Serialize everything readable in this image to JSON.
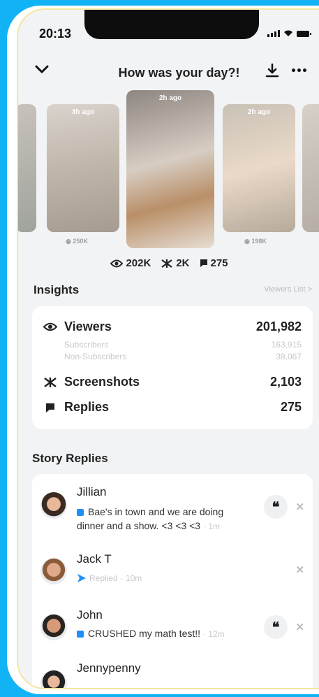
{
  "status_bar": {
    "time": "20:13"
  },
  "header": {
    "title": "How was your day?!"
  },
  "thumbnails": [
    {
      "ago": "",
      "views": ""
    },
    {
      "ago": "3h ago",
      "views": "250K"
    },
    {
      "ago": "2h ago",
      "views": ""
    },
    {
      "ago": "2h ago",
      "views": "198K"
    },
    {
      "ago": "",
      "views": ""
    }
  ],
  "stats": {
    "views": "202K",
    "screenshots": "2K",
    "replies": "275"
  },
  "insights": {
    "title": "Insights",
    "viewers_list": "Viewers List >",
    "viewers_label": "Viewers",
    "viewers_value": "201,982",
    "subscribers_label": "Subscribers",
    "subscribers_value": "163,915",
    "non_subscribers_label": "Non-Subscribers",
    "non_subscribers_value": "38,067",
    "screenshots_label": "Screenshots",
    "screenshots_value": "2,103",
    "replies_label": "Replies",
    "replies_value": "275"
  },
  "story_replies": {
    "title": "Story Replies",
    "items": [
      {
        "name": "Jillian",
        "msg_line1": "Bae's in town and we are doing",
        "msg_line2": "dinner and a show. <3 <3 <3",
        "time": "1m"
      },
      {
        "name": "Jack T",
        "msg_line1": "Replied",
        "time": "10m"
      },
      {
        "name": "John",
        "msg_line1": "CRUSHED my math test!!",
        "time": "12m"
      },
      {
        "name": "Jennypenny"
      }
    ]
  },
  "colors": {
    "accent_blue": "#1f8ff5",
    "bezel": "#12b3f5"
  }
}
